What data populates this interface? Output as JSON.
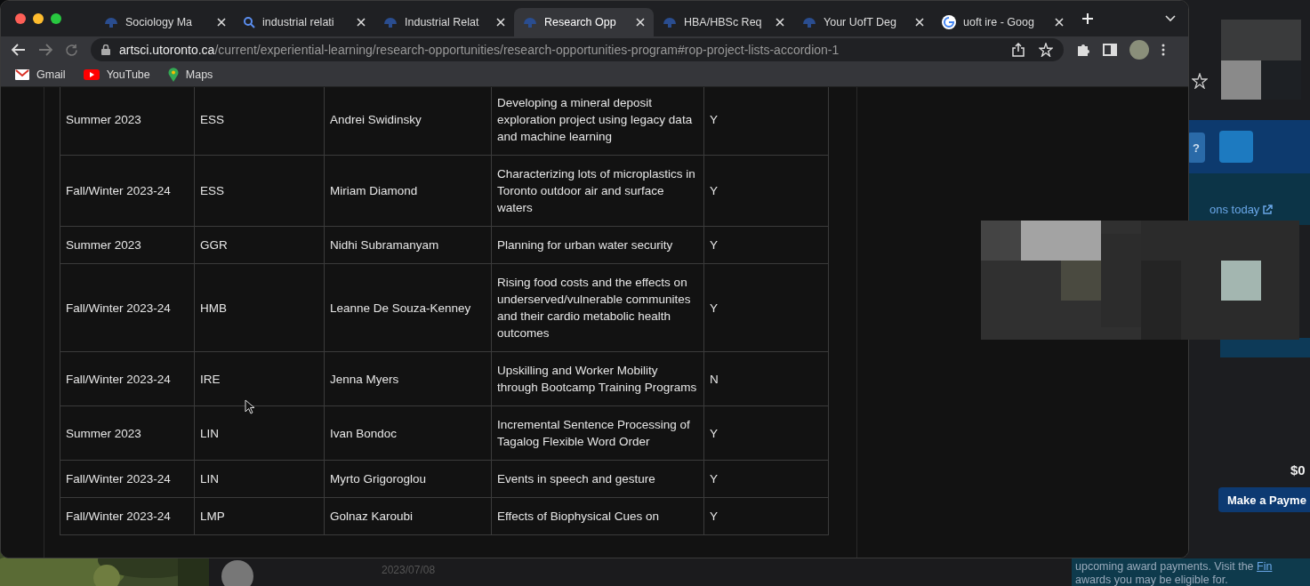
{
  "browser": {
    "tabs": [
      {
        "title": "Sociology Ma",
        "kind": "globe",
        "selected": false
      },
      {
        "title": "industrial relati",
        "kind": "search",
        "selected": false
      },
      {
        "title": "Industrial Relat",
        "kind": "globe",
        "selected": false
      },
      {
        "title": "Research Opp",
        "kind": "globe",
        "selected": true
      },
      {
        "title": "HBA/HBSc Req",
        "kind": "globe",
        "selected": false
      },
      {
        "title": "Your UofT Deg",
        "kind": "globe",
        "selected": false
      },
      {
        "title": "uoft ire - Goog",
        "kind": "google",
        "selected": false
      }
    ],
    "address_host": "artsci.utoronto.ca",
    "address_path": "/current/experiential-learning/research-opportunities/research-opportunities-program#rop-project-lists-accordion-1",
    "bookmarks": [
      {
        "label": "Gmail",
        "kind": "gmail"
      },
      {
        "label": "YouTube",
        "kind": "youtube"
      },
      {
        "label": "Maps",
        "kind": "maps"
      }
    ]
  },
  "table": {
    "rows": [
      {
        "cells": [
          "Summer 2023",
          "ESS",
          "Andrei Swidinsky",
          "Developing a mineral deposit exploration project using legacy data and machine learning",
          "Y"
        ]
      },
      {
        "cells": [
          "Fall/Winter 2023-24",
          "ESS",
          "Miriam Diamond",
          "Characterizing lots of microplastics in Toronto outdoor air and surface waters",
          "Y"
        ]
      },
      {
        "cells": [
          "Summer 2023",
          "GGR",
          "Nidhi Subramanyam",
          "Planning for urban water security",
          "Y"
        ]
      },
      {
        "cells": [
          "Fall/Winter 2023-24",
          "HMB",
          "Leanne De Souza-Kenney",
          "Rising food costs and the effects on underserved/vulnerable communites and their cardio metabolic health outcomes",
          "Y"
        ]
      },
      {
        "cells": [
          "Fall/Winter 2023-24",
          "IRE",
          "Jenna Myers",
          "Upskilling and Worker Mobility through Bootcamp Training Programs",
          "N"
        ]
      },
      {
        "cells": [
          "Summer 2023",
          "LIN",
          "Ivan Bondoc",
          "Incremental Sentence Processing of Tagalog Flexible Word Order",
          "Y"
        ]
      },
      {
        "cells": [
          "Fall/Winter 2023-24",
          "LIN",
          "Myrto Grigoroglou",
          "Events in speech and gesture",
          "Y"
        ]
      },
      {
        "cells": [
          "Fall/Winter 2023-24",
          "LMP",
          "Golnaz Karoubi",
          "Effects of Biophysical Cues on",
          "Y"
        ]
      }
    ]
  },
  "background_window": {
    "help_label": "?",
    "link_text": "ons today",
    "amount": "$0",
    "button": "Make a Payme",
    "notice_text": "upcoming award payments. Visit the",
    "notice_link": "Fin",
    "notice_line_2": "awards you may be eligible for."
  },
  "chat": {
    "date": "2023/07/08"
  }
}
